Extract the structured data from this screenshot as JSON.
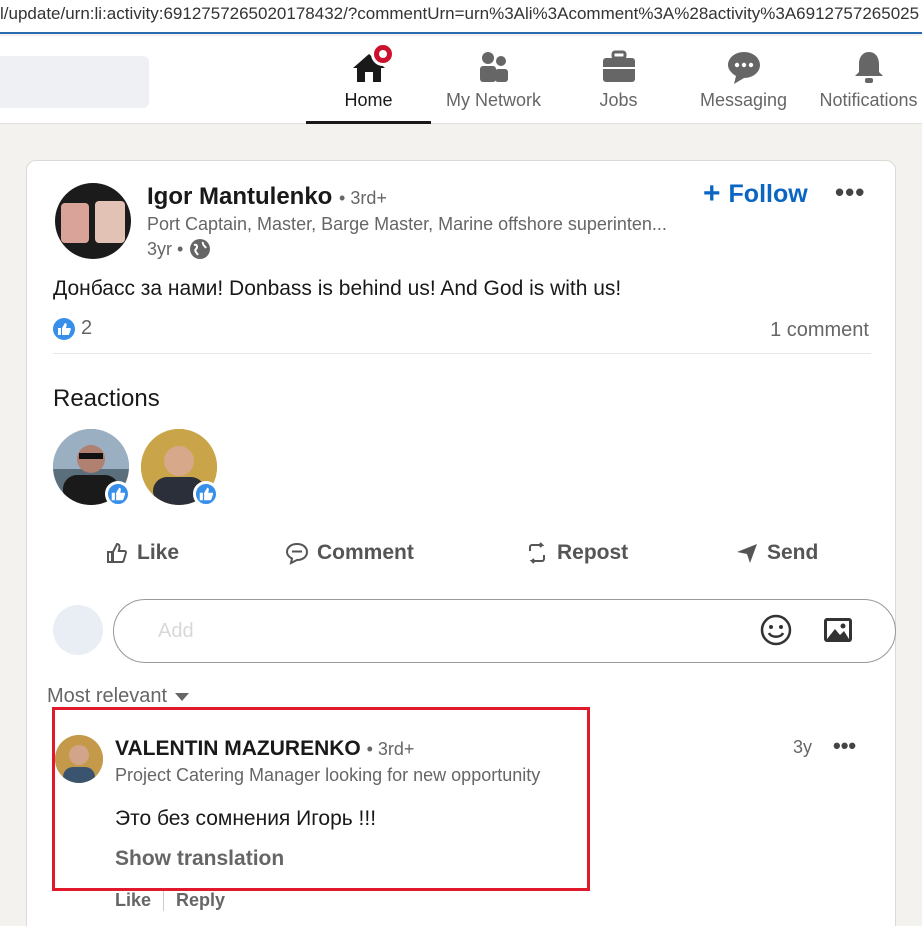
{
  "browser": {
    "url": "l/update/urn:li:activity:6912757265020178432/?commentUrn=urn%3Ali%3Acomment%3A%28activity%3A6912757265025"
  },
  "nav": {
    "items": [
      {
        "label": "Home",
        "icon": "home-icon",
        "active": true
      },
      {
        "label": "My Network",
        "icon": "network-icon"
      },
      {
        "label": "Jobs",
        "icon": "briefcase-icon"
      },
      {
        "label": "Messaging",
        "icon": "chat-icon"
      },
      {
        "label": "Notifications",
        "icon": "bell-icon"
      }
    ]
  },
  "post": {
    "author": "Igor Mantulenko",
    "degree": "• 3rd+",
    "headline": "Port Captain, Master, Barge Master, Marine offshore superinten...",
    "time": "3yr •",
    "follow_label": "Follow",
    "text": "Донбасс за нами! Donbass is behind us! And God is with us!",
    "reaction_count": "2",
    "comment_count": "1 comment"
  },
  "reactions": {
    "title": "Reactions"
  },
  "actions": {
    "like": "Like",
    "comment": "Comment",
    "repost": "Repost",
    "send": "Send"
  },
  "comment_box": {
    "placeholder": "Add"
  },
  "sort": {
    "label": "Most relevant"
  },
  "comment": {
    "author": "VALENTIN MAZURENKO",
    "degree": "• 3rd+",
    "headline": "Project Catering Manager looking for new opportunity",
    "time": "3y",
    "text": "Это без сомнения Игорь !!!",
    "translate_label": "Show translation",
    "like_label": "Like",
    "reply_label": "Reply"
  },
  "colors": {
    "accent": "#0a66c2",
    "highlight": "#e0192b",
    "badge": "#cb112d",
    "like_blue": "#378fe9"
  }
}
